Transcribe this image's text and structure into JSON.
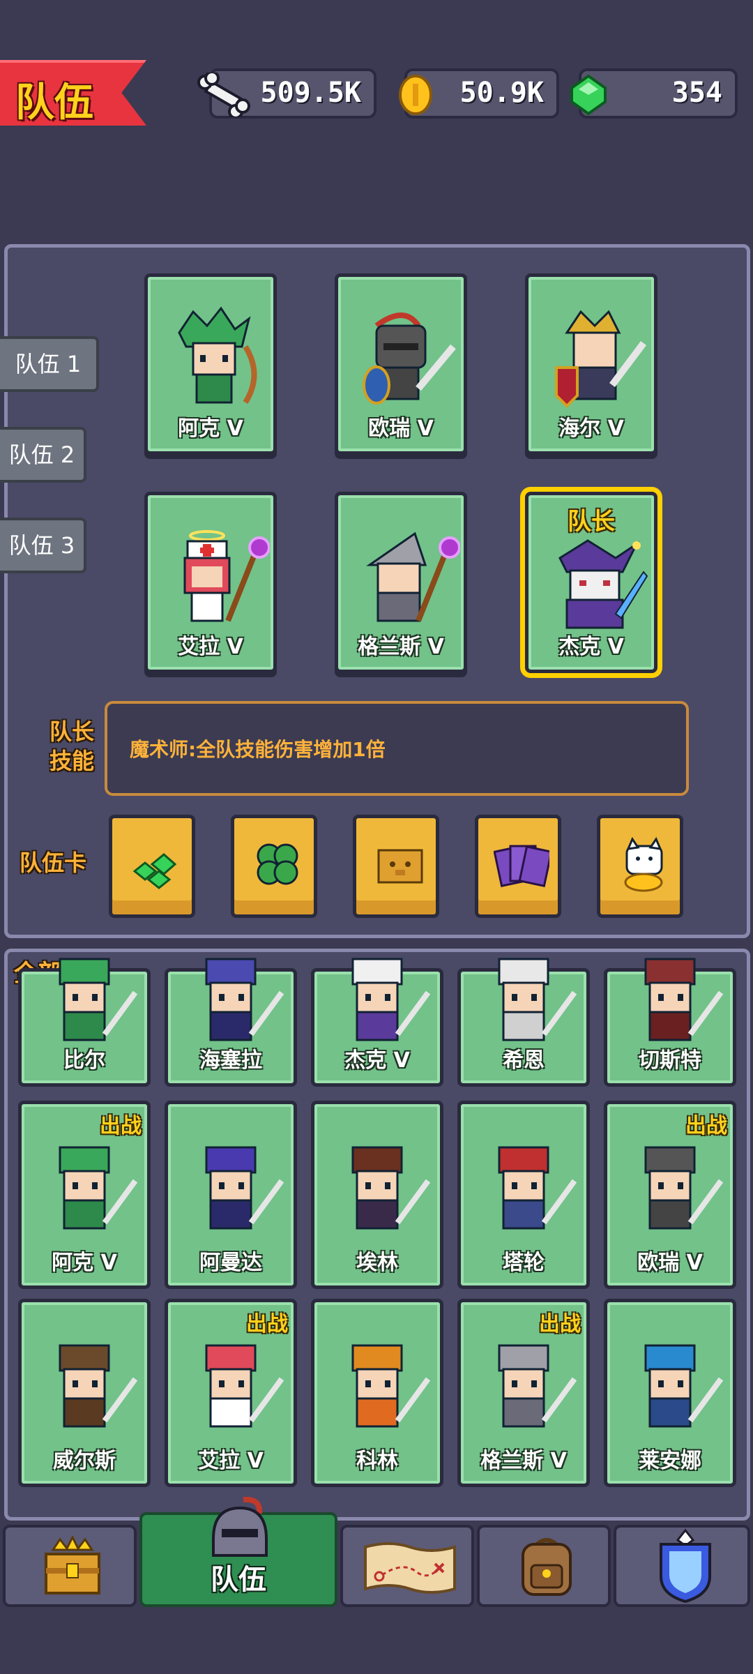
{
  "header": {
    "title": "队伍",
    "bones": "509.5K",
    "coins": "50.9K",
    "gems": "354"
  },
  "team_tabs": [
    "队伍 1",
    "队伍 2",
    "队伍 3"
  ],
  "team": [
    {
      "name": "阿克 V"
    },
    {
      "name": "欧瑞 V"
    },
    {
      "name": "海尔 V"
    },
    {
      "name": "艾拉 V"
    },
    {
      "name": "格兰斯 V"
    },
    {
      "name": "杰克 V",
      "tag": "队长"
    }
  ],
  "captain_skill": {
    "label_line1": "队长",
    "label_line2": "技能",
    "text": "魔术师:全队技能伤害增加1倍"
  },
  "team_cards": {
    "label": "队伍卡",
    "icons": [
      "green-gems-icon",
      "clover-icon",
      "pig-box-icon",
      "purple-cards-icon",
      "lucky-cat-icon"
    ]
  },
  "all_heroes": {
    "title": "全部英雄",
    "deploy_badge": "出战",
    "rows": [
      [
        {
          "name": "比尔"
        },
        {
          "name": "海塞拉"
        },
        {
          "name": "杰克 V"
        },
        {
          "name": "希恩"
        },
        {
          "name": "切斯特"
        }
      ],
      [
        {
          "name": "阿克 V",
          "deployed": true
        },
        {
          "name": "阿曼达"
        },
        {
          "name": "埃林"
        },
        {
          "name": "塔轮"
        },
        {
          "name": "欧瑞 V",
          "deployed": true
        }
      ],
      [
        {
          "name": "威尔斯"
        },
        {
          "name": "艾拉 V",
          "deployed": true
        },
        {
          "name": "科林"
        },
        {
          "name": "格兰斯 V",
          "deployed": true
        },
        {
          "name": "莱安娜"
        }
      ]
    ]
  },
  "nav": {
    "items": [
      "treasure-chest-icon",
      "helmet-icon",
      "map-scroll-icon",
      "backpack-icon",
      "shield-crystal-icon"
    ],
    "active_label": "队伍"
  },
  "colors": {
    "card_green": "#72c28a",
    "captain_border": "#ffd000",
    "accent_orange": "#ffb23a",
    "title_red": "#e8343f"
  }
}
